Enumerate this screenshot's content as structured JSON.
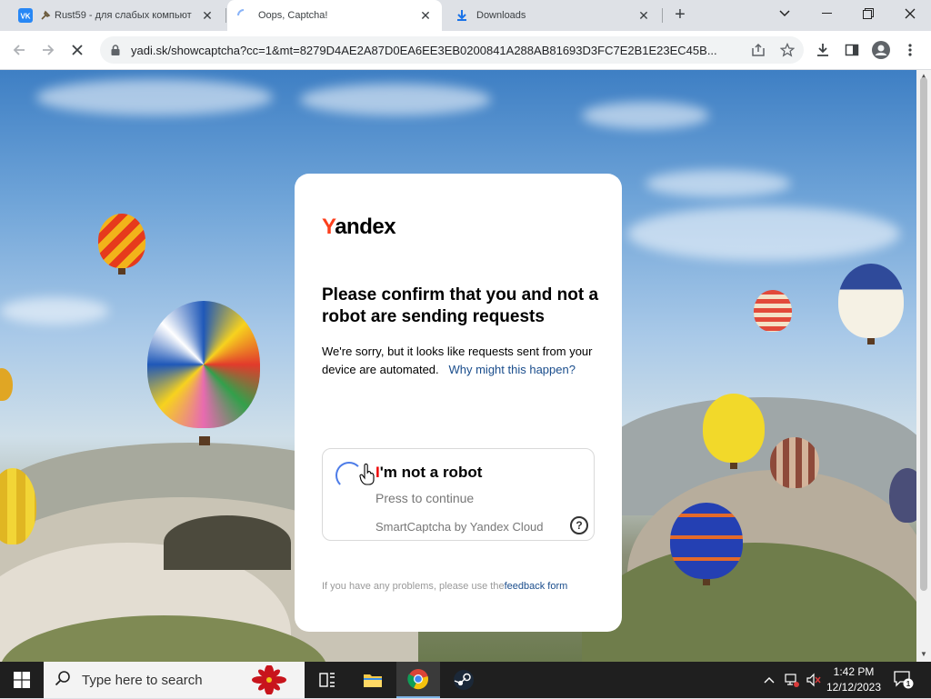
{
  "browser": {
    "tabs": [
      {
        "title": "Rust59 - для слабых компьют",
        "favicon": "vk-icon",
        "active": false
      },
      {
        "title": "Oops, Captcha!",
        "favicon": "loading-spinner-icon",
        "active": true
      },
      {
        "title": "Downloads",
        "favicon": "download-icon",
        "active": false
      }
    ],
    "url": "yadi.sk/showcaptcha?cc=1&mt=8279D4AE2A87D0EA6EE3EB0200841A288AB81693D3FC7E2B1E23EC45B..."
  },
  "captcha": {
    "logo_first": "Y",
    "logo_rest": "andex",
    "heading": "Please confirm that you and not a robot are sending requests",
    "description": "We're sorry, but it looks like requests sent from your device are automated.",
    "why_link": "Why might this happen?",
    "checkbox_mark": "I",
    "checkbox_label": "'m not a robot",
    "press_text": "Press to continue",
    "brand_text": "SmartCaptcha by Yandex Cloud",
    "help_glyph": "?",
    "footer_text": "If you have any problems, please use the",
    "footer_link": "feedback form"
  },
  "taskbar": {
    "search_placeholder": "Type here to search",
    "time": "1:42 PM",
    "date": "12/12/2023",
    "notification_count": "1"
  },
  "colors": {
    "yandex_red": "#fc3f1d",
    "link_blue": "#1a4d8c",
    "spinner_blue": "#4d7ce8"
  }
}
